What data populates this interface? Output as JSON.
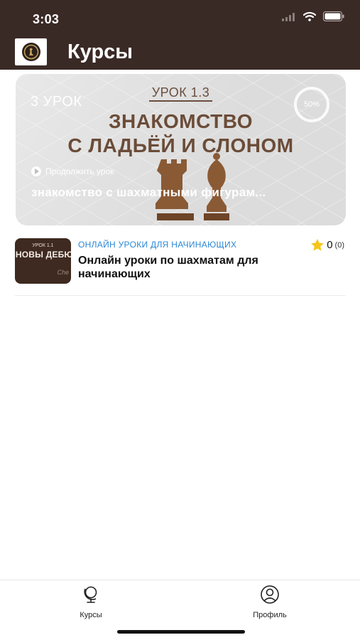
{
  "status_bar": {
    "time": "3:03",
    "icons": [
      "signal-icon",
      "wifi-icon",
      "battery-icon"
    ]
  },
  "header": {
    "title": "Курсы",
    "logo_icon": "chess-club-logo"
  },
  "banner": {
    "lesson_count": "3 УРОК",
    "lesson_number": "УРОК 1.3",
    "title_line1": "ЗНАКОМСТВО",
    "title_line2": "С ЛАДЬЁЙ И СЛОНОМ",
    "progress": "50%",
    "progress_value": 0.5,
    "continue_label": "Продолжить урок",
    "subtitle": "знакомство с шахматными фигурам..."
  },
  "course": {
    "category": "ОНЛАЙН УРОКИ ДЛЯ НАЧИНАЮЩИХ",
    "title": "Онлайн уроки по шахматам для начинающих",
    "rating": "0",
    "rating_count": "(0)",
    "thumb_small": "УРОК 1.1",
    "thumb_big": "СНОВЫ ДЕБЮТ",
    "thumb_script": "Che"
  },
  "tabs": [
    {
      "label": "Курсы",
      "icon": "globe-icon"
    },
    {
      "label": "Профиль",
      "icon": "profile-icon"
    }
  ],
  "colors": {
    "header_bg": "#3a2a26",
    "accent_blue": "#2a87d6",
    "banner_title": "#6b4c38",
    "star": "#f5c518"
  }
}
